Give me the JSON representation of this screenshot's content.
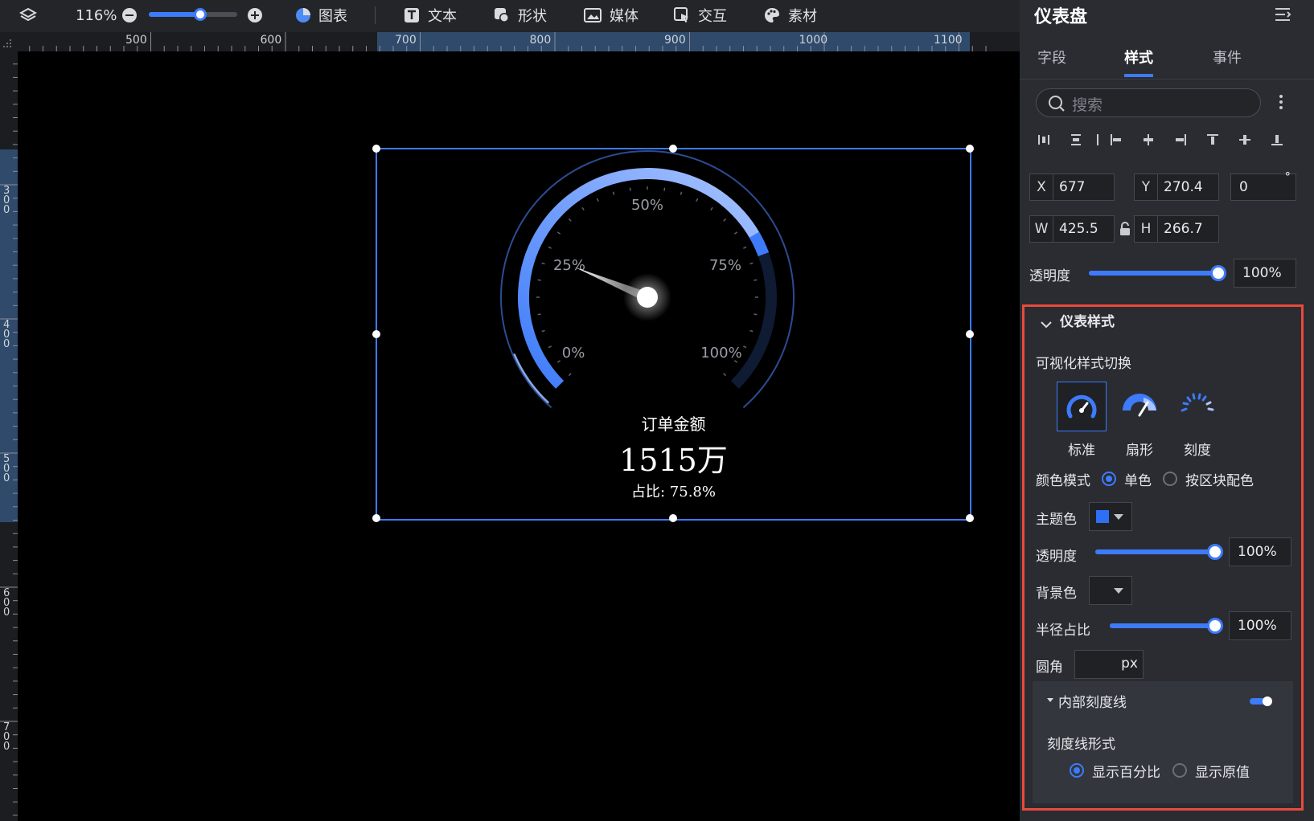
{
  "toolbar": {
    "zoom": "116%",
    "zoom_level": 0.55,
    "items": [
      {
        "label": "图表",
        "icon": "pie-chart-icon"
      },
      {
        "label": "文本",
        "icon": "text-icon"
      },
      {
        "label": "形状",
        "icon": "shape-icon"
      },
      {
        "label": "媒体",
        "icon": "image-icon"
      },
      {
        "label": "交互",
        "icon": "interaction-icon"
      },
      {
        "label": "素材",
        "icon": "palette-icon"
      }
    ]
  },
  "ruler": {
    "h_ticks": [
      "500",
      "600",
      "700",
      "800",
      "900",
      "1000",
      "1100"
    ],
    "v_ticks": [
      "300",
      "400",
      "500",
      "600",
      "700"
    ]
  },
  "gauge": {
    "tick_labels": [
      "0%",
      "25%",
      "50%",
      "75%",
      "100%"
    ],
    "name": "订单金额",
    "value": "1515万",
    "ratio_text": "占比: 75.8%",
    "ratio": 0.758,
    "needle_ratio": 0.25,
    "accent": "#3d7bfa"
  },
  "panel": {
    "title": "仪表盘",
    "tabs": [
      "字段",
      "样式",
      "事件"
    ],
    "active_tab": "样式",
    "search_placeholder": "搜索",
    "position": {
      "x": "677",
      "y": "270.4",
      "rotation": "0",
      "w": "425.5",
      "h": "266.7",
      "x_label": "X",
      "y_label": "Y",
      "w_label": "W",
      "h_label": "H",
      "deg": "°"
    },
    "opacity_label": "透明度",
    "opacity_value": "100%",
    "section": {
      "title": "仪表样式",
      "switch_label": "可视化样式切换",
      "styles": [
        {
          "label": "标准",
          "icon": "gauge-standard-icon",
          "selected": true
        },
        {
          "label": "扇形",
          "icon": "gauge-fan-icon",
          "selected": false
        },
        {
          "label": "刻度",
          "icon": "gauge-tick-icon",
          "selected": false
        }
      ],
      "color_mode_label": "颜色模式",
      "color_mode_options": [
        "单色",
        "按区块配色"
      ],
      "color_mode_selected": "单色",
      "theme_color_label": "主题色",
      "theme_color": "#2f6ff5",
      "opacity_label": "透明度",
      "opacity_value": "100%",
      "bg_color_label": "背景色",
      "radius_ratio_label": "半径占比",
      "radius_ratio_value": "100%",
      "corner_label": "圆角",
      "corner_unit": "px",
      "inner_tick_label": "内部刻度线",
      "inner_tick_enabled": true,
      "tick_form_label": "刻度线形式",
      "tick_form_options": [
        "显示百分比",
        "显示原值"
      ],
      "tick_form_selected": "显示百分比"
    }
  }
}
